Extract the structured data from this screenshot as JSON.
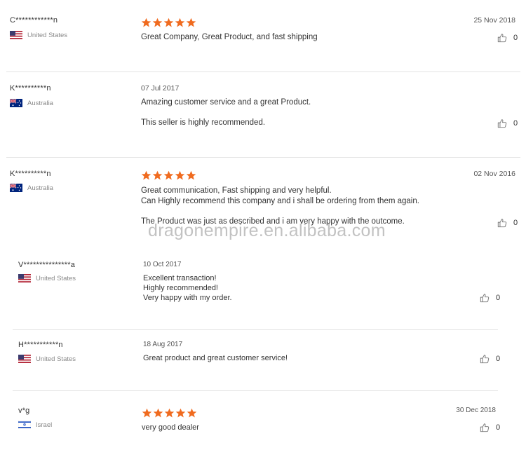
{
  "reviews": [
    {
      "name": "C************n",
      "country": "United States",
      "flag": "us",
      "stars": 5,
      "date": "25 Nov 2018",
      "lines": [
        "Great Company, Great Product, and fast shipping"
      ],
      "likes": "0"
    },
    {
      "name": "K**********n",
      "country": "Australia",
      "flag": "au",
      "date": "07 Jul 2017",
      "lines": [
        "Amazing customer service and a great Product.",
        "",
        "This seller is highly recommended."
      ],
      "likes": "0"
    },
    {
      "name": "K**********n",
      "country": "Australia",
      "flag": "au",
      "stars": 5,
      "date": "02 Nov 2016",
      "lines": [
        "Great communication, Fast shipping and very helpful.",
        "Can Highly recommend this company and i shall be ordering from them again.",
        "",
        "The Product was just as described and i am very happy with the outcome."
      ],
      "likes": "0"
    },
    {
      "name": "V***************a",
      "country": "United States",
      "flag": "us",
      "date": "10 Oct 2017",
      "lines": [
        "Excellent transaction!",
        "Highly recommended!",
        "Very happy with my order."
      ],
      "likes": "0"
    },
    {
      "name": "H***********n",
      "country": "United States",
      "flag": "us",
      "date": "18 Aug 2017",
      "lines": [
        "Great product and great customer service!"
      ],
      "likes": "0"
    },
    {
      "name": "v*g",
      "country": "Israel",
      "flag": "il",
      "stars": 5,
      "date": "30 Dec 2018",
      "lines": [
        "very good dealer"
      ],
      "likes": "0"
    }
  ],
  "watermark": "dragonempire.en.alibaba.com",
  "colors": {
    "star": "#f06b1f",
    "divider": "#e3e3e3"
  },
  "icons": {
    "like": "thumbs-up-icon",
    "star": "star-icon"
  }
}
